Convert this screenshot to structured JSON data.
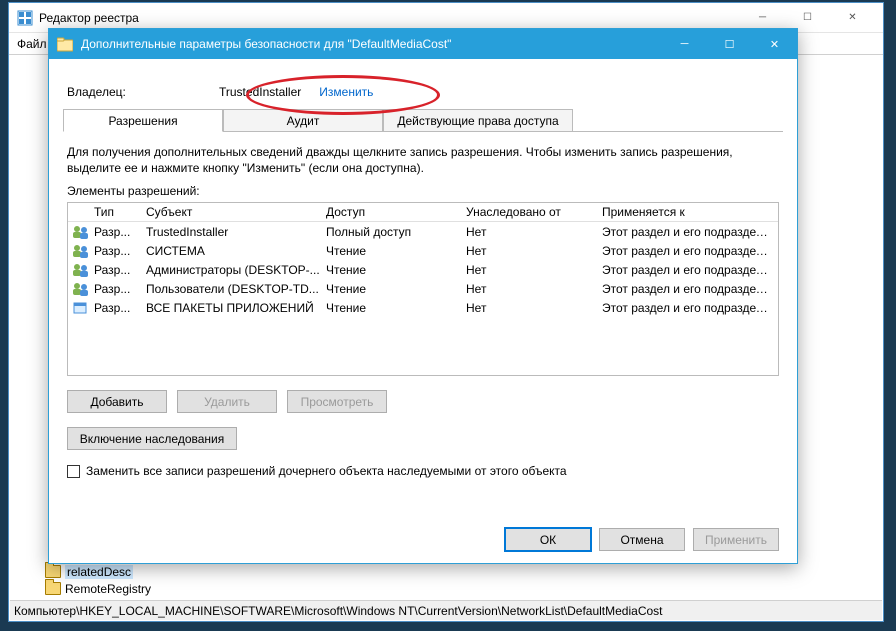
{
  "regedit": {
    "title": "Редактор реестра",
    "menu_file": "Файл",
    "tree_item_remote": "RemoteRegistry",
    "statusbar": "Компьютер\\HKEY_LOCAL_MACHINE\\SOFTWARE\\Microsoft\\Windows NT\\CurrentVersion\\NetworkList\\DefaultMediaCost"
  },
  "adv": {
    "title": "Дополнительные параметры безопасности для \"DefaultMediaCost\"",
    "owner_label": "Владелец:",
    "owner_value": "TrustedInstaller",
    "owner_change": "Изменить",
    "tabs": {
      "permissions": "Разрешения",
      "audit": "Аудит",
      "effective": "Действующие права доступа"
    },
    "hint": "Для получения дополнительных сведений дважды щелкните запись разрешения. Чтобы изменить запись разрешения, выделите ее и нажмите кнопку \"Изменить\" (если она доступна).",
    "entries_label": "Элементы разрешений:",
    "columns": {
      "type": "Тип",
      "subject": "Субъект",
      "access": "Доступ",
      "inherited": "Унаследовано от",
      "applies": "Применяется к"
    },
    "rows": [
      {
        "type": "Разр...",
        "subject": "TrustedInstaller",
        "access": "Полный доступ",
        "inherited": "Нет",
        "applies": "Этот раздел и его подразделы",
        "icon": "users"
      },
      {
        "type": "Разр...",
        "subject": "СИСТЕМА",
        "access": "Чтение",
        "inherited": "Нет",
        "applies": "Этот раздел и его подразделы",
        "icon": "users"
      },
      {
        "type": "Разр...",
        "subject": "Администраторы (DESKTOP-...",
        "access": "Чтение",
        "inherited": "Нет",
        "applies": "Этот раздел и его подразделы",
        "icon": "users"
      },
      {
        "type": "Разр...",
        "subject": "Пользователи (DESKTOP-TD...",
        "access": "Чтение",
        "inherited": "Нет",
        "applies": "Этот раздел и его подразделы",
        "icon": "users"
      },
      {
        "type": "Разр...",
        "subject": "ВСЕ ПАКЕТЫ ПРИЛОЖЕНИЙ",
        "access": "Чтение",
        "inherited": "Нет",
        "applies": "Этот раздел и его подразделы",
        "icon": "package"
      }
    ],
    "buttons": {
      "add": "Добавить",
      "remove": "Удалить",
      "view": "Просмотреть",
      "enable_inherit": "Включение наследования",
      "ok": "ОК",
      "cancel": "Отмена",
      "apply": "Применить"
    },
    "replace_checkbox": "Заменить все записи разрешений дочернего объекта наследуемыми от этого объекта"
  }
}
